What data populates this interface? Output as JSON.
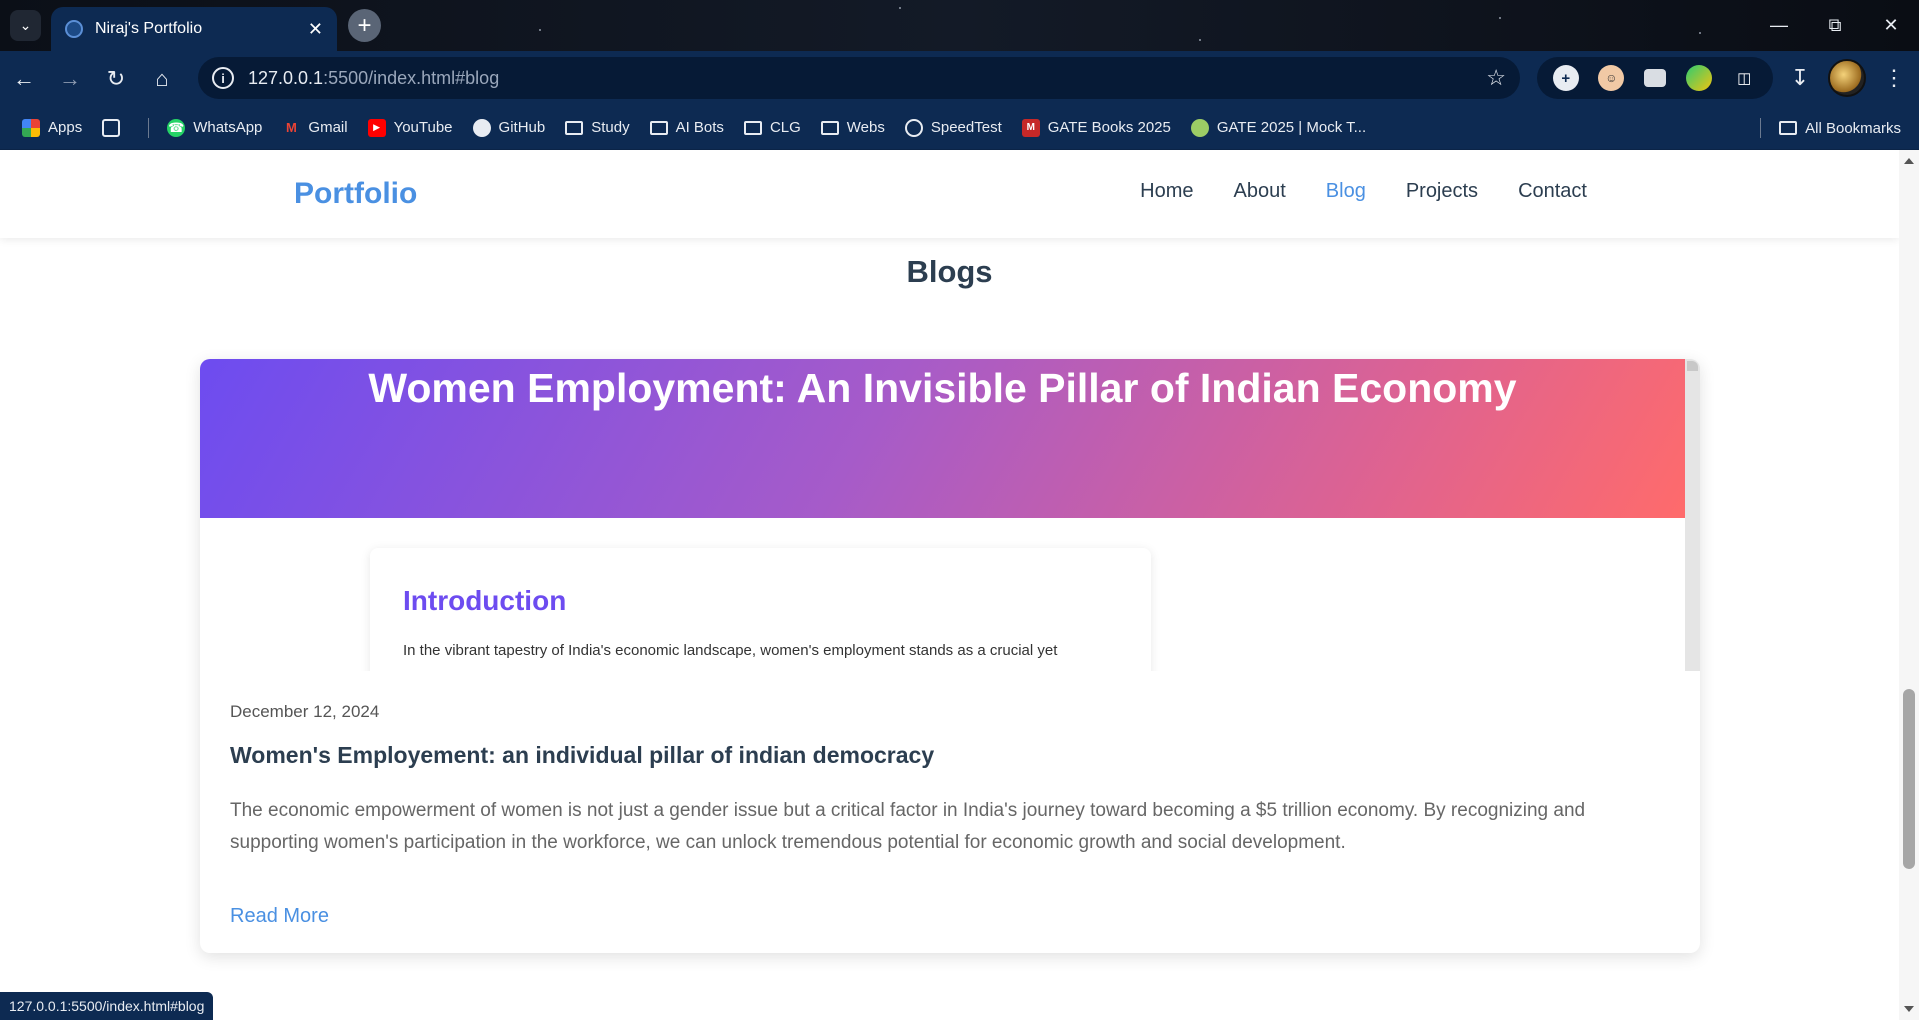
{
  "browser": {
    "tab_title": "Niraj's Portfolio",
    "url_host": "127.0.0.1",
    "url_rest": ":5500/index.html#blog",
    "status_url": "127.0.0.1:5500/index.html#blog",
    "bookmarks": [
      {
        "label": "Apps",
        "icon": "apps-grid-icon"
      },
      {
        "label": "WhatsApp",
        "icon": "whatsapp-icon"
      },
      {
        "label": "Gmail",
        "icon": "gmail-icon"
      },
      {
        "label": "YouTube",
        "icon": "youtube-icon"
      },
      {
        "label": "GitHub",
        "icon": "github-icon"
      },
      {
        "label": "Study",
        "icon": "folder-icon"
      },
      {
        "label": "AI Bots",
        "icon": "folder-icon"
      },
      {
        "label": "CLG",
        "icon": "folder-icon"
      },
      {
        "label": "Webs",
        "icon": "folder-icon"
      },
      {
        "label": "SpeedTest",
        "icon": "speedtest-icon"
      },
      {
        "label": "GATE Books 2025",
        "icon": "made-easy-icon"
      },
      {
        "label": "GATE 2025 | Mock T...",
        "icon": "mock-test-icon"
      }
    ],
    "all_bookmarks": "All Bookmarks"
  },
  "site": {
    "logo": "Portfolio",
    "nav": [
      "Home",
      "About",
      "Blog",
      "Projects",
      "Contact"
    ],
    "active_nav": "Blog",
    "section_title": "Blogs"
  },
  "post": {
    "hero_title": "Women Employment: An Invisible Pillar of Indian Economy",
    "intro_heading": "Introduction",
    "intro_text": "In the vibrant tapestry of India's economic landscape, women's employment stands as a crucial yet",
    "date": "December 12, 2024",
    "title": "Women's Employement: an individual pillar of indian democracy",
    "excerpt": "The economic empowerment of women is not just a gender issue but a critical factor in India's journey toward becoming a $5 trillion economy. By recognizing and supporting women's participation in the workforce, we can unlock tremendous potential for economic growth and social development.",
    "read_more": "Read More"
  },
  "colors": {
    "accent": "#4a90e2",
    "heading": "#2c3e50",
    "chrome": "#0d2a52",
    "gradient_start": "#6d4cf0",
    "gradient_end": "#ff6b6b"
  }
}
